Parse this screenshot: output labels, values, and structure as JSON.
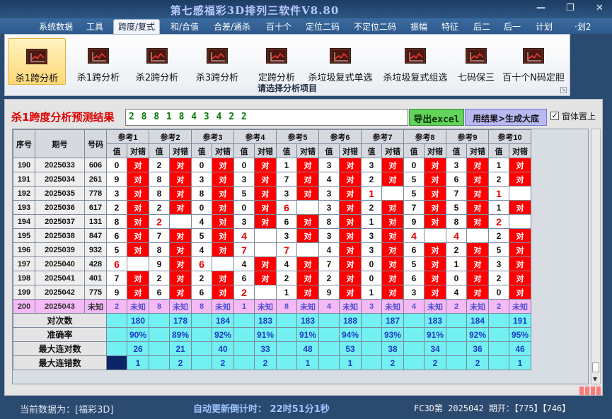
{
  "window": {
    "title": "第七感福彩3D排列三软件V8.80",
    "minimize": "—",
    "restore": "❐",
    "close": "✕"
  },
  "menu": [
    {
      "label": "系统数据",
      "active": false
    },
    {
      "label": "工具",
      "active": false
    },
    {
      "label": "跨度/复式",
      "active": true
    },
    {
      "label": "和/合值",
      "active": false
    },
    {
      "label": "合差/通杀",
      "active": false
    },
    {
      "label": "百十个",
      "active": false
    },
    {
      "label": "定位二码",
      "active": false
    },
    {
      "label": "不定位二码",
      "active": false
    },
    {
      "label": "振幅",
      "active": false
    },
    {
      "label": "特征",
      "active": false
    },
    {
      "label": "后二",
      "active": false
    },
    {
      "label": "后一",
      "active": false
    },
    {
      "label": "计划",
      "active": false
    },
    {
      "label": "·划2",
      "active": false
    }
  ],
  "ribbon": {
    "buttons": [
      {
        "label": "杀1跨分析",
        "active": true,
        "icon": "chart-icon"
      },
      {
        "label": "杀1跨分析",
        "active": false,
        "icon": "chart-icon"
      },
      {
        "label": "杀2跨分析",
        "active": false,
        "icon": "chart-icon"
      },
      {
        "label": "杀3跨分析",
        "active": false,
        "icon": "chart-icon"
      },
      {
        "label": "定跨分析",
        "active": false,
        "icon": "chart-icon"
      },
      {
        "label": "杀垃圾复式单选",
        "active": false,
        "icon": "chart-icon"
      },
      {
        "label": "杀垃圾复式组选",
        "active": false,
        "icon": "chart-icon"
      },
      {
        "label": "七码保三",
        "active": false,
        "icon": "chart-icon"
      },
      {
        "label": "百十个N码定胆",
        "active": false,
        "icon": "chart-icon"
      }
    ],
    "group_label": "请选择分析项目",
    "launcher": "↘"
  },
  "panel": {
    "result_title": "杀1跨度分析预测结果",
    "result_value": "2 8 8 1 8 4 3 4 2 2",
    "export_label": "导出excel",
    "generate_label": "用结果>生成大底",
    "topmost_checked": "✓",
    "topmost_label": "窗体置上"
  },
  "table": {
    "headers": {
      "seq": "序号",
      "period": "期号",
      "number": "号码",
      "value": "值",
      "check": "对错"
    },
    "refs": [
      "参考1",
      "参考2",
      "参考3",
      "参考4",
      "参考5",
      "参考6",
      "参考7",
      "参考8",
      "参考9",
      "参考10"
    ],
    "ok_text": "对",
    "rows": [
      {
        "seq": "190",
        "period": "2025033",
        "number": "606",
        "vals": [
          "0",
          "2",
          "0",
          "0",
          "1",
          "3",
          "3",
          "0",
          "3",
          "1"
        ],
        "ok": [
          1,
          1,
          1,
          1,
          1,
          1,
          1,
          1,
          1,
          1
        ],
        "red": []
      },
      {
        "seq": "191",
        "period": "2025034",
        "number": "261",
        "vals": [
          "9",
          "8",
          "3",
          "3",
          "7",
          "4",
          "2",
          "5",
          "6",
          "2"
        ],
        "ok": [
          1,
          1,
          1,
          1,
          1,
          1,
          1,
          1,
          1,
          1
        ],
        "red": []
      },
      {
        "seq": "192",
        "period": "2025035",
        "number": "778",
        "vals": [
          "3",
          "8",
          "8",
          "5",
          "3",
          "3",
          "1",
          "5",
          "7",
          "1"
        ],
        "ok": [
          1,
          1,
          1,
          1,
          1,
          1,
          0,
          1,
          1,
          0
        ],
        "red": [
          6,
          9
        ]
      },
      {
        "seq": "193",
        "period": "2025036",
        "number": "617",
        "vals": [
          "2",
          "2",
          "0",
          "0",
          "6",
          "3",
          "2",
          "7",
          "5",
          "1"
        ],
        "ok": [
          1,
          1,
          1,
          1,
          0,
          1,
          1,
          1,
          1,
          1
        ],
        "red": [
          4
        ]
      },
      {
        "seq": "194",
        "period": "2025037",
        "number": "131",
        "vals": [
          "8",
          "2",
          "4",
          "3",
          "6",
          "8",
          "1",
          "9",
          "8",
          "2"
        ],
        "ok": [
          1,
          0,
          1,
          1,
          1,
          1,
          1,
          1,
          1,
          0
        ],
        "red": [
          1,
          9
        ]
      },
      {
        "seq": "195",
        "period": "2025038",
        "number": "847",
        "vals": [
          "6",
          "7",
          "5",
          "4",
          "3",
          "3",
          "3",
          "4",
          "4",
          "2"
        ],
        "ok": [
          1,
          1,
          1,
          0,
          1,
          1,
          1,
          0,
          0,
          1
        ],
        "red": [
          3,
          7,
          8
        ]
      },
      {
        "seq": "196",
        "period": "2025039",
        "number": "932",
        "vals": [
          "5",
          "8",
          "4",
          "7",
          "7",
          "4",
          "3",
          "6",
          "2",
          "5"
        ],
        "ok": [
          1,
          1,
          1,
          0,
          0,
          1,
          1,
          1,
          1,
          1
        ],
        "red": [
          3,
          4
        ]
      },
      {
        "seq": "197",
        "period": "2025040",
        "number": "428",
        "vals": [
          "6",
          "9",
          "6",
          "4",
          "4",
          "7",
          "0",
          "5",
          "1",
          "3"
        ],
        "ok": [
          0,
          1,
          0,
          1,
          1,
          1,
          1,
          1,
          1,
          1
        ],
        "red": [
          0,
          2
        ]
      },
      {
        "seq": "198",
        "period": "2025041",
        "number": "401",
        "vals": [
          "7",
          "2",
          "2",
          "6",
          "2",
          "2",
          "0",
          "6",
          "0",
          "2"
        ],
        "ok": [
          1,
          1,
          1,
          1,
          1,
          1,
          1,
          1,
          1,
          1
        ],
        "red": []
      },
      {
        "seq": "199",
        "period": "2025042",
        "number": "775",
        "vals": [
          "9",
          "6",
          "6",
          "2",
          "1",
          "9",
          "1",
          "3",
          "4",
          "0"
        ],
        "ok": [
          1,
          1,
          1,
          0,
          1,
          1,
          1,
          1,
          1,
          1
        ],
        "red": [
          3
        ]
      }
    ],
    "pending": {
      "seq": "200",
      "period": "2025043",
      "number": "未知",
      "vals": [
        "2",
        "8",
        "8",
        "1",
        "8",
        "4",
        "3",
        "4",
        "2",
        "2"
      ],
      "status": "未知"
    },
    "stats": [
      {
        "label": "对次数",
        "values": [
          "180",
          "178",
          "184",
          "183",
          "183",
          "188",
          "187",
          "183",
          "184",
          "191"
        ]
      },
      {
        "label": "准确率",
        "values": [
          "90%",
          "89%",
          "92%",
          "91%",
          "91%",
          "94%",
          "93%",
          "91%",
          "92%",
          "95%"
        ]
      },
      {
        "label": "最大连对数",
        "values": [
          "26",
          "21",
          "40",
          "33",
          "48",
          "53",
          "38",
          "34",
          "36",
          "46"
        ]
      },
      {
        "label": "最大连错数",
        "values": [
          "1",
          "2",
          "2",
          "2",
          "1",
          "1",
          "2",
          "2",
          "2",
          "1"
        ]
      }
    ]
  },
  "status": {
    "current_data": "当前数据为：[福彩3D]",
    "countdown": "自动更新倒计时： 22时51分1秒",
    "latest": "FC3D第 2025042 期开：【775】【746】"
  }
}
